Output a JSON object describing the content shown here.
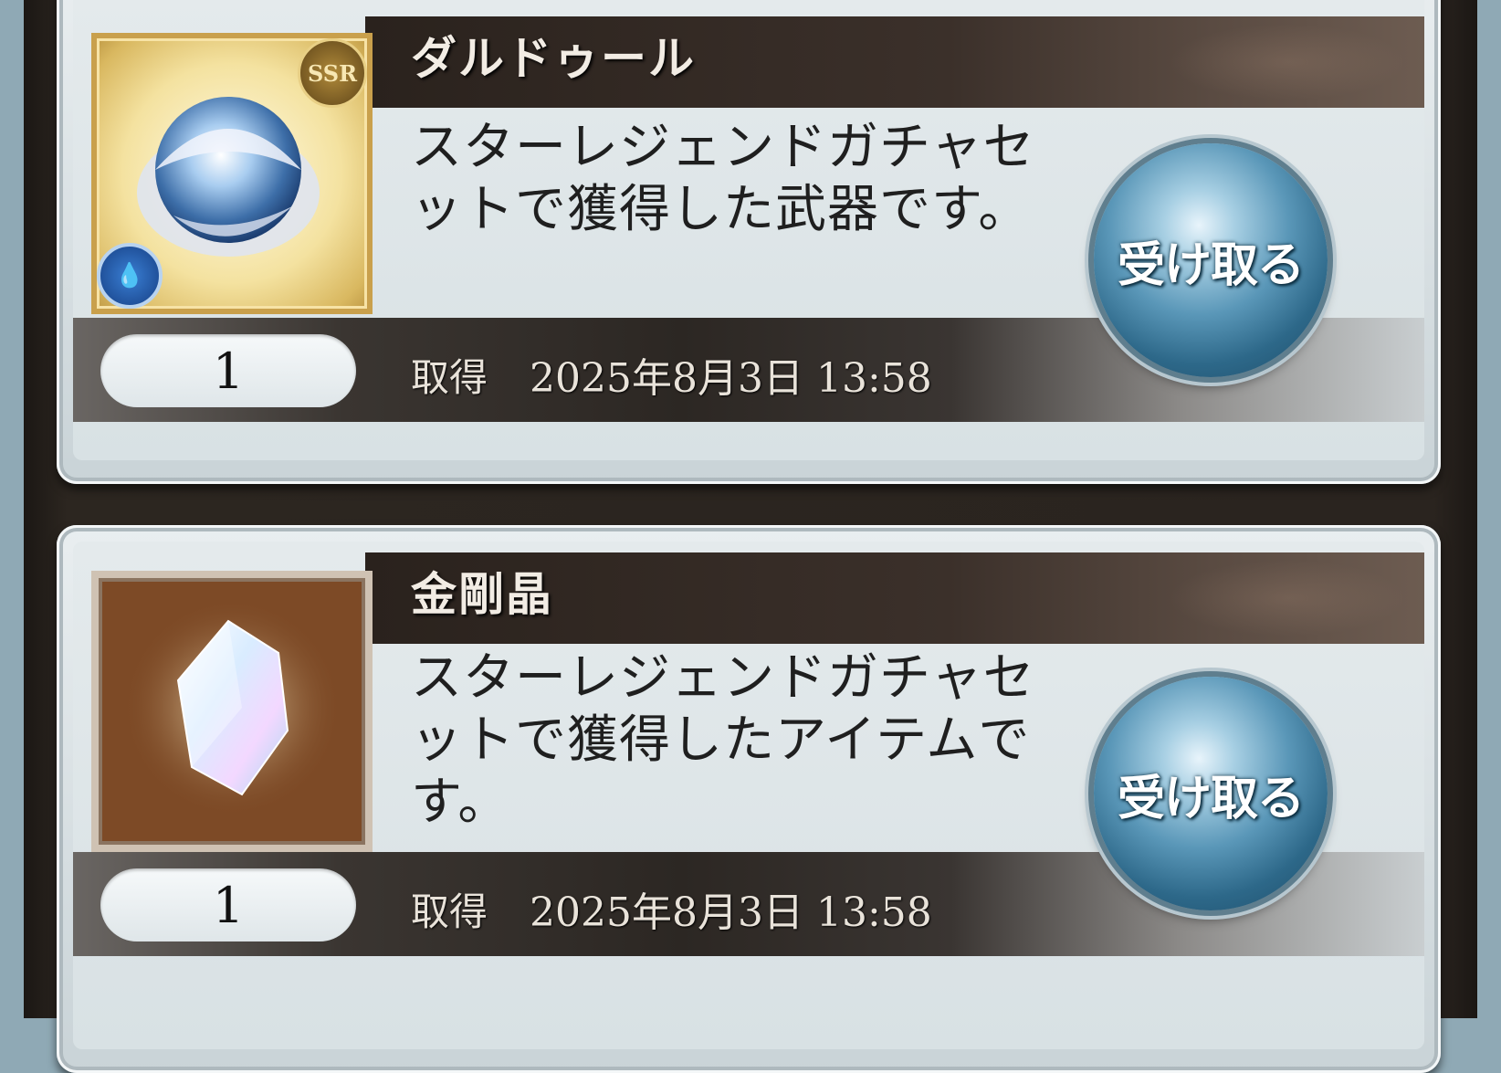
{
  "items": [
    {
      "name": "ダルドゥール",
      "description": "スターレジェンドガチャセットで獲得した武器です。",
      "quantity": "1",
      "acquired_label": "取得",
      "acquired_date": "2025年8月3日 13:58",
      "button_label": "受け取る",
      "rarity": "SSR",
      "element_icon": "water-element-icon",
      "thumbnail": "weapon-orb-icon"
    },
    {
      "name": "金剛晶",
      "description": "スターレジェンドガチャセットで獲得したアイテムです。",
      "quantity": "1",
      "acquired_label": "取得",
      "acquired_date": "2025年8月3日 13:58",
      "button_label": "受け取る",
      "thumbnail": "crystal-icon"
    }
  ],
  "colors": {
    "title_bar": "#2a221d",
    "button_blue": "#5a97b8",
    "card_bg": "#e4eaec"
  }
}
